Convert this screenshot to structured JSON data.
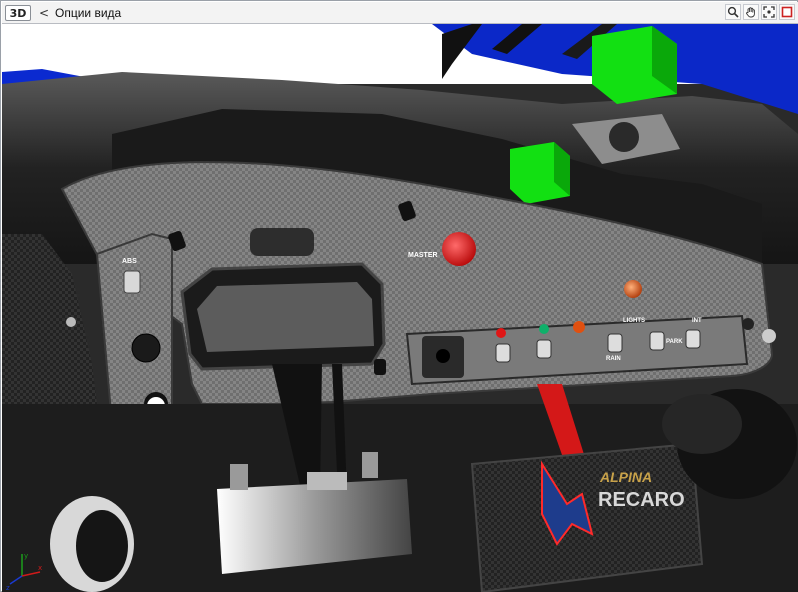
{
  "toolbar": {
    "mode_badge": "3D",
    "back_glyph": "<",
    "title": "Опции вида",
    "tools": [
      {
        "name": "zoom-icon"
      },
      {
        "name": "pan-hand-icon"
      },
      {
        "name": "fit-view-icon"
      },
      {
        "name": "close-view-icon"
      }
    ]
  },
  "scene": {
    "labels": {
      "abs": "ABS",
      "master": "MASTER",
      "lights": "LIGHTS",
      "park": "PARK",
      "int": "INT",
      "rain": "RAIN",
      "brand_alpina": "ALPINA",
      "brand_recaro": "RECARO"
    },
    "axis": {
      "x": "x",
      "y": "y",
      "z": "z"
    }
  },
  "colors": {
    "sky": "#ffffff",
    "car_body_blue": "#0b28c8",
    "carbon_dark": "#1c1c1c",
    "panel_grey": "#8a8a8a",
    "green_box": "#12e012",
    "red_button": "#e01616",
    "accent_red_frame": "#cc2222"
  }
}
